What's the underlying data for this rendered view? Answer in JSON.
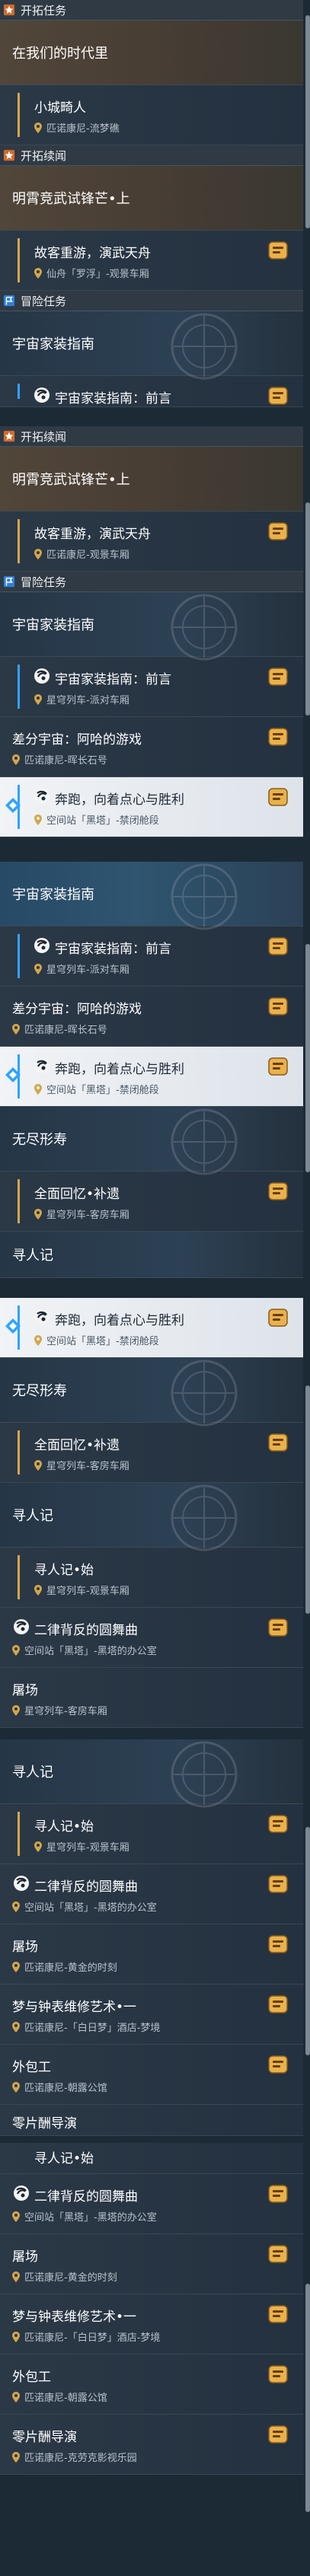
{
  "section1": {
    "cat1": "开拓任务",
    "banner1": "在我们的时代里",
    "item1": {
      "title": "小城畸人",
      "loc": "匹诺康尼-流梦礁"
    },
    "cat2": "开拓续闻",
    "banner2": "明霄竞武试锋芒•上",
    "item2": {
      "title": "故客重游，演武天舟",
      "loc": "仙舟「罗浮」-观景车厢"
    },
    "cat3": "冒险任务",
    "banner3": "宇宙家装指南",
    "item3": {
      "title": "宇宙家装指南：前言"
    }
  },
  "section2": {
    "cat1": "开拓续闻",
    "banner1": "明霄竞武试锋芒•上",
    "item1": {
      "title": "故客重游，演武天舟",
      "loc": "匹诺康尼-观景车厢"
    },
    "cat2": "冒险任务",
    "banner2": "宇宙家装指南",
    "items": [
      {
        "title": "宇宙家装指南：前言",
        "loc": "星穹列车-派对车厢",
        "icon": true
      },
      {
        "title": "差分宇宙：阿哈的游戏",
        "loc": "匹诺康尼-晖长石号",
        "icon": false
      },
      {
        "title": "奔跑，向着点心与胜利",
        "loc": "空间站「黑塔」-禁闭舱段",
        "icon": true,
        "active": true
      }
    ]
  },
  "section3": {
    "banner1": "宇宙家装指南",
    "items": [
      {
        "title": "宇宙家装指南：前言",
        "loc": "星穹列车-派对车厢",
        "icon": true
      },
      {
        "title": "差分宇宙：阿哈的游戏",
        "loc": "匹诺康尼-晖长石号",
        "icon": false
      },
      {
        "title": "奔跑，向着点心与胜利",
        "loc": "空间站「黑塔」-禁闭舱段",
        "icon": true,
        "active": true
      }
    ],
    "banner2": "无尽形寿",
    "item4": {
      "title": "全面回忆•补遗",
      "loc": "星穹列车-客房车厢"
    },
    "banner3": "寻人记"
  },
  "section4": {
    "active": {
      "title": "奔跑，向着点心与胜利",
      "loc": "空间站「黑塔」-禁闭舱段"
    },
    "banner1": "无尽形寿",
    "item1": {
      "title": "全面回忆•补遗",
      "loc": "星穹列车-客房车厢"
    },
    "banner2": "寻人记",
    "items": [
      {
        "title": "寻人记•始",
        "loc": "星穹列车-观景车厢",
        "icon": false
      },
      {
        "title": "二律背反的圆舞曲",
        "loc": "空间站「黑塔」-黑塔的办公室",
        "icon": true
      },
      {
        "title": "屠场",
        "loc": "星穹列车-客房车厢",
        "icon": false
      }
    ]
  },
  "section5": {
    "banner1": "寻人记",
    "items": [
      {
        "title": "寻人记•始",
        "loc": "星穹列车-观景车厢",
        "icon": false
      },
      {
        "title": "二律背反的圆舞曲",
        "loc": "空间站「黑塔」-黑塔的办公室",
        "icon": true
      },
      {
        "title": "屠场",
        "loc": "匹诺康尼-黄金的时刻",
        "icon": false
      },
      {
        "title": "梦与钟表维修艺术•一",
        "loc": "匹诺康尼-「白日梦」酒店-梦境",
        "icon": false
      },
      {
        "title": "外包工",
        "loc": "匹诺康尼-朝露公馆",
        "icon": false
      },
      {
        "title": "零片酬导演",
        "loc": "",
        "icon": false
      }
    ]
  },
  "section6": {
    "items": [
      {
        "title": "寻人记•始",
        "loc": "",
        "icon": false
      },
      {
        "title": "二律背反的圆舞曲",
        "loc": "空间站「黑塔」-黑塔的办公室",
        "icon": true
      },
      {
        "title": "屠场",
        "loc": "匹诺康尼-黄金的时刻",
        "icon": false
      },
      {
        "title": "梦与钟表维修艺术•一",
        "loc": "匹诺康尼-「白日梦」酒店-梦境",
        "icon": false
      },
      {
        "title": "外包工",
        "loc": "匹诺康尼-朝露公馆",
        "icon": false
      },
      {
        "title": "零片酬导演",
        "loc": "匹诺康尼-克劳克影视乐园",
        "icon": false
      }
    ]
  }
}
